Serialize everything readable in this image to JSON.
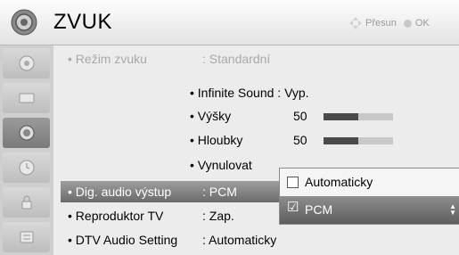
{
  "header": {
    "title": "ZVUK",
    "hint_move": "Přesun",
    "hint_ok": "OK",
    "icon": "speaker-icon"
  },
  "sidebar": {
    "items": [
      {
        "icon": "picture-icon",
        "active": false
      },
      {
        "icon": "tv-icon",
        "active": false
      },
      {
        "icon": "speaker-icon",
        "active": true
      },
      {
        "icon": "clock-icon",
        "active": false
      },
      {
        "icon": "lock-icon",
        "active": false
      },
      {
        "icon": "option-icon",
        "active": false
      }
    ]
  },
  "menu": {
    "rows": [
      {
        "name": "• Režim zvuku",
        "value": ": Standardní",
        "state": "dim"
      },
      {
        "name": "• Dig. audio výstup",
        "value": ": PCM",
        "state": "selected"
      },
      {
        "name": "• Reproduktor TV",
        "value": ": Zap.",
        "state": "normal"
      },
      {
        "name": "• DTV Audio Setting",
        "value": ": Automaticky",
        "state": "normal"
      }
    ],
    "sub": {
      "infinite_sound": "• Infinite Sound : Vyp.",
      "treble_label": "• Výšky",
      "treble_value": "50",
      "treble_level": 0.5,
      "bass_label": "• Hloubky",
      "bass_value": "50",
      "bass_level": 0.5,
      "reset_label": "• Vynulovat"
    }
  },
  "popup": {
    "options": [
      {
        "label": "Automaticky",
        "checked": false
      },
      {
        "label": "PCM",
        "checked": true
      }
    ]
  },
  "colors": {
    "selected_bar": "#7a7a7a",
    "level_fill": "#4a4a4a"
  }
}
